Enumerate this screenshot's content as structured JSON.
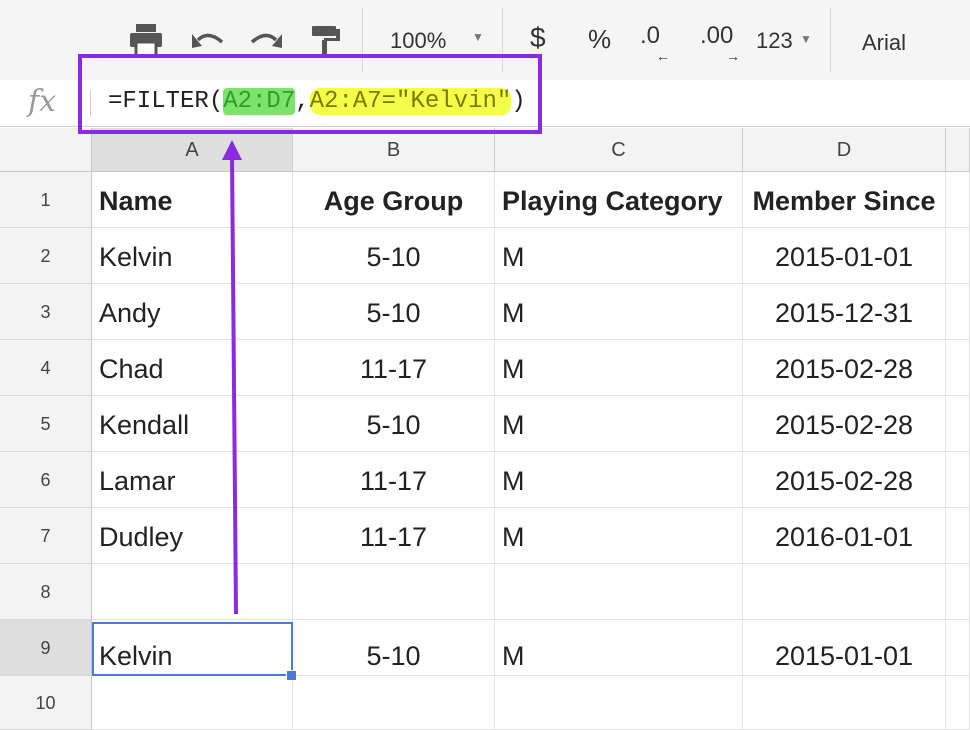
{
  "toolbar": {
    "zoom": "100%",
    "currency": "$",
    "percent": "%",
    "decrease_decimals": ".0",
    "increase_decimals": ".00",
    "number_format": "123",
    "font": "Arial"
  },
  "formula_bar": {
    "fx_label": "fx",
    "prefix": "=FILTER(",
    "range_arg": "A2:D7",
    "comma": ",",
    "condition_arg": "A2:A7=\"Kelvin\"",
    "suffix": ")"
  },
  "sheet": {
    "columns": [
      "A",
      "B",
      "C",
      "D"
    ],
    "rows": [
      "1",
      "2",
      "3",
      "4",
      "5",
      "6",
      "7",
      "8",
      "9",
      "10"
    ],
    "cells": [
      [
        "Name",
        "Age Group",
        "Playing Category",
        "Member Since"
      ],
      [
        "Kelvin",
        "5-10",
        "M",
        "2015-01-01"
      ],
      [
        "Andy",
        "5-10",
        "M",
        "2015-12-31"
      ],
      [
        "Chad",
        "11-17",
        "M",
        "2015-02-28"
      ],
      [
        "Kendall",
        "5-10",
        "M",
        "2015-02-28"
      ],
      [
        "Lamar",
        "11-17",
        "M",
        "2015-02-28"
      ],
      [
        "Dudley",
        "11-17",
        "M",
        "2016-01-01"
      ],
      [
        "",
        "",
        "",
        ""
      ],
      [
        "Kelvin",
        "5-10",
        "M",
        "2015-01-01"
      ],
      [
        "",
        "",
        "",
        ""
      ]
    ]
  },
  "colors": {
    "annotation": "#8a2be2",
    "range_highlight": "#7de36a",
    "condition_highlight": "#f4ff4a",
    "selection": "#4a7bd6"
  },
  "icons": [
    "print-icon",
    "undo-icon",
    "redo-icon",
    "paint-format-icon",
    "caret-down-icon",
    "arrow-left-icon",
    "arrow-right-icon"
  ]
}
